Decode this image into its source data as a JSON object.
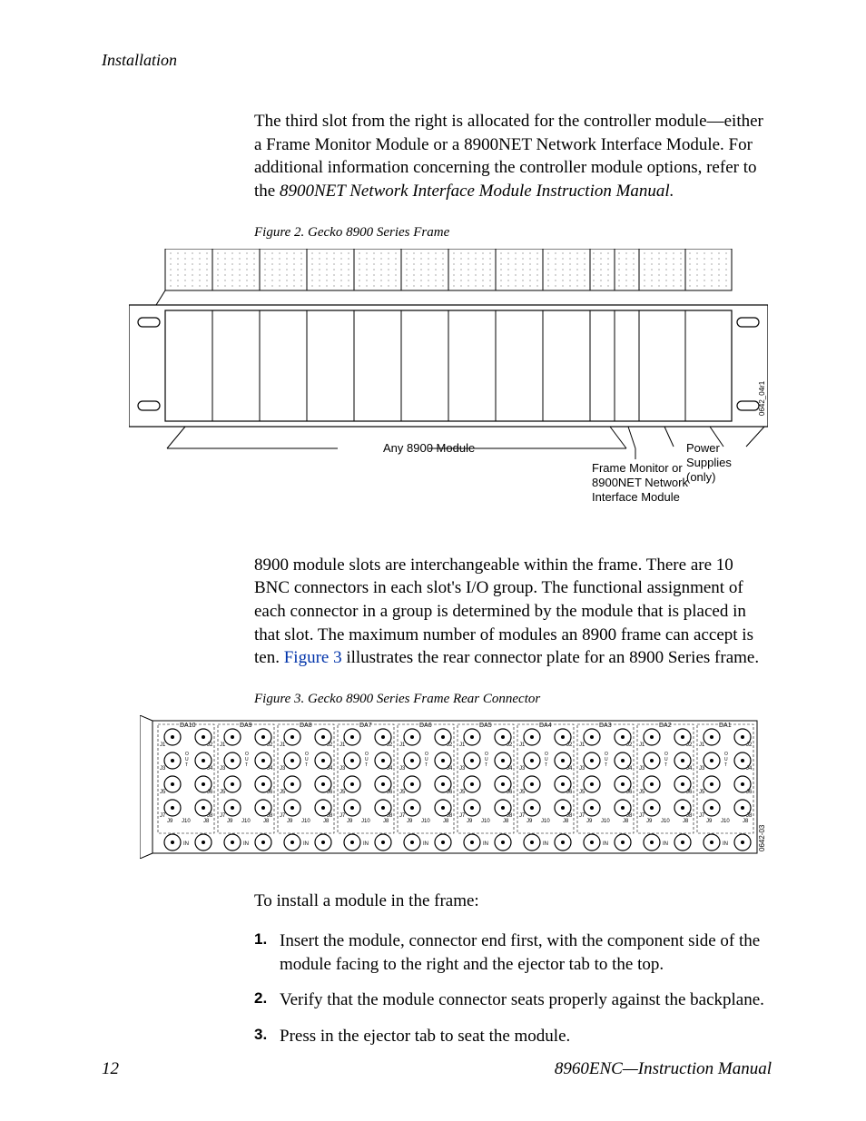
{
  "header": {
    "running": "Installation"
  },
  "para1_a": "The third slot from the right is allocated for the controller module—either a Frame Monitor Module or a 8900NET Network Interface Module. For additional information concerning the controller module options, refer to the ",
  "para1_b": "8900NET Network Interface Module Instruction Manual.",
  "fig2": {
    "caption": "Figure 2.  Gecko 8900 Series Frame",
    "label_any": "Any 8900 Module",
    "label_fm1": "Frame Monitor or",
    "label_fm2": "8900NET Network",
    "label_fm3": "Interface Module",
    "label_ps1": "Power",
    "label_ps2": "Supplies",
    "label_ps3": "(only)",
    "code": "0642_04r1"
  },
  "para2_a": "8900 module slots are interchangeable within the frame. There are 10 BNC connectors in each slot's I/O group. The functional assignment of each con­nector in a group is determined by the module that is placed in that slot. The maximum number of modules an 8900 frame can accept is ten. ",
  "para2_link": "Figure 3",
  "para2_b": " illustrates the rear connector plate for an 8900 Series frame.",
  "fig3": {
    "caption": "Figure 3.  Gecko 8900 Series Frame Rear Connector",
    "groups": [
      "DA10",
      "DA9",
      "DA8",
      "DA7",
      "DA6",
      "DA5",
      "DA4",
      "DA3",
      "DA2",
      "DA1"
    ],
    "code": "0642-03"
  },
  "para3": "To install a module in the frame:",
  "steps": [
    "Insert the module, connector end first, with the component side of the module facing to the right and the ejector tab to the top.",
    "Verify that the module connector seats properly against the backplane.",
    "Press in the ejector tab to seat the module."
  ],
  "footer": {
    "page": "12",
    "title": "8960ENC—Instruction Manual"
  }
}
